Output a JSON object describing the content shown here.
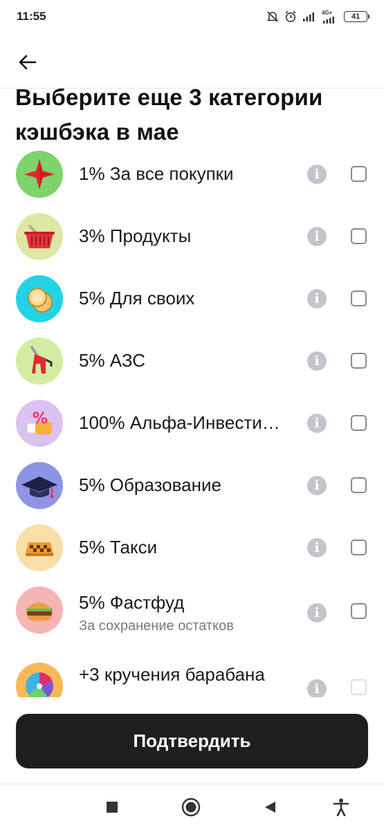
{
  "status_bar": {
    "time": "11:55",
    "network_label": "4G+",
    "battery": "41",
    "icons": [
      "mute-bell-icon",
      "alarm-icon",
      "signal-icon",
      "signal-4g-icon",
      "battery-icon"
    ]
  },
  "app_bar": {
    "back_icon": "arrow-left-icon"
  },
  "title": "Выберите еще 3 категории кэшбэка в мае",
  "categories": [
    {
      "label": "1% За все покупки",
      "icon": "red-star-icon",
      "bg": "#7ed36b"
    },
    {
      "label": "3% Продукты",
      "icon": "basket-icon",
      "bg": "#dfe7a6"
    },
    {
      "label": "5% Для своих",
      "icon": "coins-icon",
      "bg": "#22d3e6"
    },
    {
      "label": "5% АЗС",
      "icon": "fuel-nozzle-icon",
      "bg": "#d4eca1"
    },
    {
      "label": "100% Альфа-Инвестиции",
      "icon": "percent-ticket-icon",
      "bg": "#dcc2ef"
    },
    {
      "label": "5% Образование",
      "icon": "graduation-cap-icon",
      "bg": "#8d94e6"
    },
    {
      "label": "5% Такси",
      "icon": "taxi-sign-icon",
      "bg": "#f8dfa8"
    },
    {
      "label": "5% Фастфуд",
      "sublabel": "За сохранение остатков",
      "icon": "burger-icon",
      "bg": "#f6b4b4"
    },
    {
      "label": "+3 кручения барабана",
      "icon": "wheel-icon",
      "bg": "#f7b957"
    }
  ],
  "confirm_label": "Подтвердить",
  "nav": {
    "icons": [
      "square-icon",
      "home-circle-icon",
      "back-triangle-icon",
      "accessibility-icon"
    ]
  },
  "colors": {
    "button_bg": "#1f1f21",
    "info_icon": "#c2c5cb",
    "checkbox_border": "#8a8a8a"
  }
}
